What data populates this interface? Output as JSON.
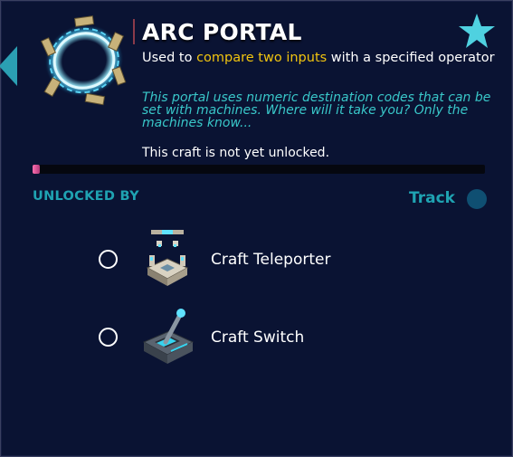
{
  "craft": {
    "title": "ARC PORTAL",
    "subtitle_prefix": "Used to ",
    "subtitle_highlight": "compare two inputs",
    "subtitle_suffix": " with a specified operator",
    "lore": "This portal uses numeric destination codes that can be set with machines. Where will it take you? Only the machines know...",
    "status": "This craft is not yet unlocked.",
    "progress": 0.016
  },
  "unlocks": {
    "heading": "UNLOCKED BY",
    "track_label": "Track",
    "requirements": [
      {
        "label": "Craft Teleporter",
        "icon": "teleporter-icon"
      },
      {
        "label": "Craft Switch",
        "icon": "switch-icon"
      }
    ]
  },
  "colors": {
    "background": "#0a1333",
    "accent_teal": "#1fa3b2",
    "lore_cyan": "#39c7c9",
    "highlight_yellow": "#f1c40f",
    "star": "#4fd1e0",
    "progress": "#ff6fb0"
  }
}
